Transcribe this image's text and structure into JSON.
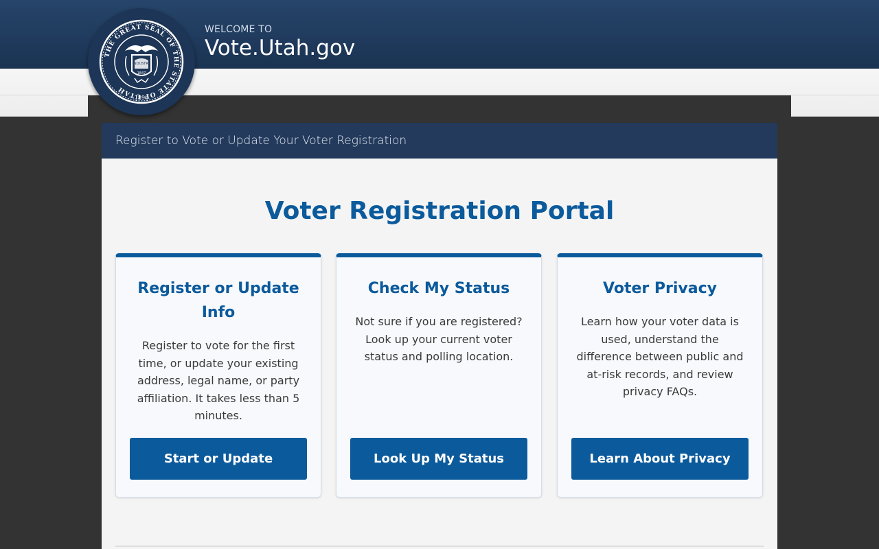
{
  "header": {
    "welcome": "WELCOME TO",
    "site_title": "Vote.Utah.gov",
    "seal": {
      "ring_text": "THE GREAT SEAL OF THE STATE OF UTAH",
      "motto": "INDUSTRY",
      "year_inner": "1847",
      "year": "1896"
    }
  },
  "panel": {
    "heading": "Register to Vote or Update Your Voter Registration",
    "title": "Voter Registration Portal"
  },
  "cards": [
    {
      "title": "Register or Update Info",
      "description": "Register to vote for the first time, or update your existing address, legal name, or party affiliation. It takes less than 5 minutes.",
      "button": "Start or Update"
    },
    {
      "title": "Check My Status",
      "description": "Not sure if you are registered? Look up your current voter status and polling location.",
      "button": "Look Up My Status"
    },
    {
      "title": "Voter Privacy",
      "description": "Learn how your voter data is used, understand the difference between public and at-risk records, and review privacy FAQs.",
      "button": "Learn About Privacy"
    }
  ],
  "colors": {
    "brand": "#0b5a9c",
    "header": "#1f3a5c",
    "panel_header": "#233a5c"
  }
}
